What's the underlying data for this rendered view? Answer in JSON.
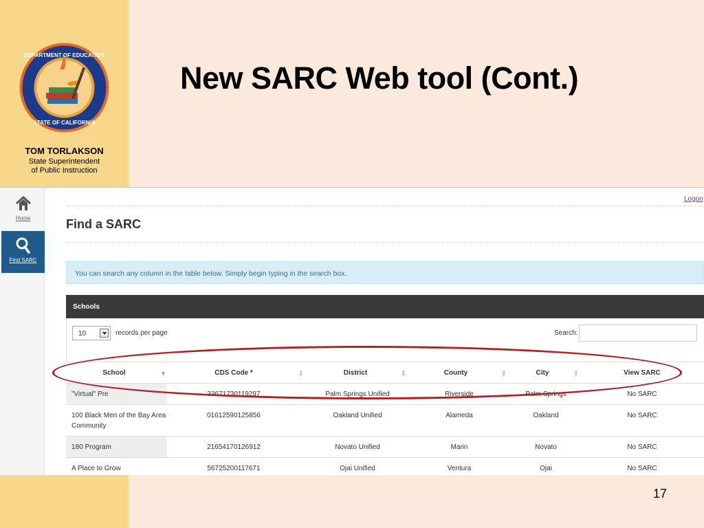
{
  "slide": {
    "title": "New SARC Web tool (Cont.)",
    "page_number": "17",
    "presenter": {
      "name": "TOM TORLAKSON",
      "role_line1": "State Superintendent",
      "role_line2": "of Public Instruction"
    },
    "logo": {
      "icon": "california-department-of-education-seal",
      "text_top": "DEPARTMENT OF EDUCATION",
      "text_bottom": "STATE OF CALIFORNIA"
    }
  },
  "app": {
    "logon_label": "Logon",
    "nav": [
      {
        "label": "Home",
        "icon": "home-icon"
      },
      {
        "label": "Find SARC",
        "icon": "search-icon"
      }
    ],
    "page_heading": "Find a SARC",
    "info_text": "You can search any column in the table below. Simply begin typing in the search box.",
    "panel_title": "Schools",
    "records_per_page": {
      "value": "10",
      "label": "records per page"
    },
    "search": {
      "label": "Search:",
      "value": ""
    },
    "table": {
      "columns": [
        "School",
        "CDS Code *",
        "District",
        "County",
        "City",
        "View SARC"
      ],
      "rows": [
        {
          "school": "\"Virtual\" Pre",
          "cds": "33671730119297",
          "district": "Palm Springs Unified",
          "county": "Riverside",
          "city": "Palm Springs",
          "view": "No SARC"
        },
        {
          "school": "100 Black Men of the Bay Area Community",
          "cds": "01612590125856",
          "district": "Oakland Unified",
          "county": "Alameda",
          "city": "Oakland",
          "view": "No SARC"
        },
        {
          "school": "180 Program",
          "cds": "21654170126912",
          "district": "Novato Unified",
          "county": "Marin",
          "city": "Novato",
          "view": "No SARC"
        },
        {
          "school": "A Place to Grow",
          "cds": "56725200117671",
          "district": "Ojai Unified",
          "county": "Ventura",
          "city": "Ojai",
          "view": "No SARC"
        }
      ]
    }
  },
  "colors": {
    "gold_panel": "#f7d88a",
    "slide_background": "#fce9de",
    "nav_active": "#1f5c8c",
    "panel_header": "#3a3a3a",
    "highlight_oval": "#b21f24"
  }
}
